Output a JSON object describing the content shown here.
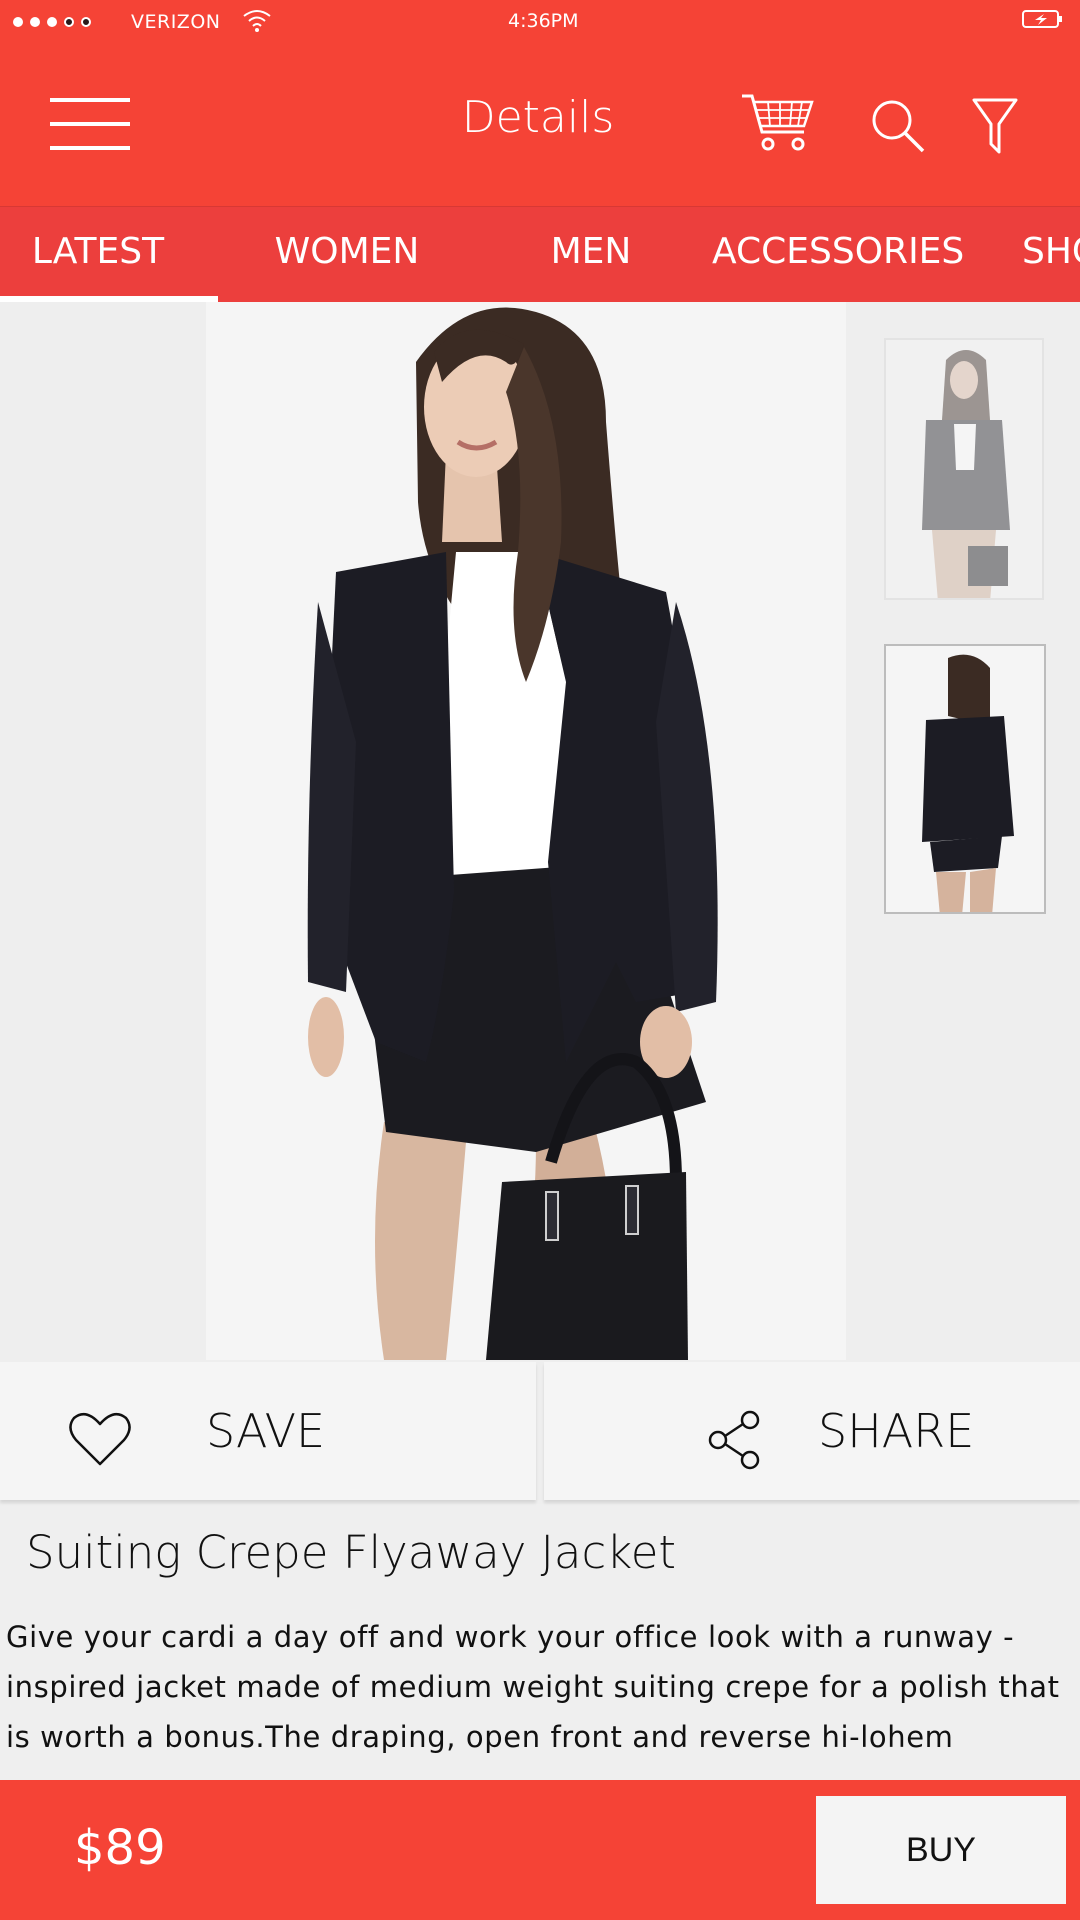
{
  "status_bar": {
    "carrier": "VERIZON",
    "time": "4:36PM"
  },
  "header": {
    "title": "Details",
    "icons": [
      "menu-icon",
      "cart-icon",
      "search-icon",
      "filter-icon"
    ]
  },
  "tabs": [
    {
      "label": "LATEST",
      "active": true
    },
    {
      "label": "WOMEN",
      "active": false
    },
    {
      "label": "MEN",
      "active": false
    },
    {
      "label": "ACCESSORIES",
      "active": false
    },
    {
      "label": "SHO",
      "active": false
    }
  ],
  "actions": {
    "save_label": "SAVE",
    "share_label": "SHARE"
  },
  "product": {
    "title": "Suiting Crepe Flyaway Jacket",
    "description": "Give your cardi a day off and work your office look with a runway -inspired jacket made of medium weight suiting crepe for a polish that is worth a bonus.The draping, open front and reverse hi-lohem",
    "price": "$89"
  },
  "bottom_bar": {
    "buy_label": "BUY"
  },
  "colors": {
    "brand_red": "#f54336",
    "tab_red": "#ec3f3d",
    "background": "#efefef",
    "button_surface": "#f5f5f5"
  }
}
